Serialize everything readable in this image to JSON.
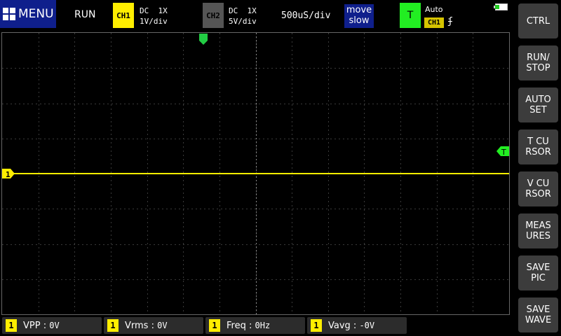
{
  "topbar": {
    "menu_label": "MENU",
    "run_state": "RUN",
    "ch1": {
      "badge": "CH1",
      "coupling": "DC  1X",
      "scale": "1V/div",
      "color": "#ffee00"
    },
    "ch2": {
      "badge": "CH2",
      "coupling": "DC  1X",
      "scale": "5V/div",
      "color": "#555555"
    },
    "timebase": "500uS/div",
    "move": {
      "line1": "move",
      "line2": "slow"
    },
    "trigger": {
      "badge": "T",
      "mode": "Auto",
      "source": "CH1",
      "edge": "ʄ",
      "color": "#22ee22"
    }
  },
  "markers": {
    "ch1_label": "1",
    "trigger_level_label": "T"
  },
  "side_buttons": [
    {
      "label": "CTRL"
    },
    {
      "label": "RUN/\nSTOP"
    },
    {
      "label": "AUTO\nSET"
    },
    {
      "label": "T CU\nRSOR"
    },
    {
      "label": "V CU\nRSOR"
    },
    {
      "label": "MEAS\nURES"
    },
    {
      "label": "SAVE\nPIC"
    },
    {
      "label": "SAVE\nWAVE"
    }
  ],
  "measurements": [
    {
      "channel": "1",
      "name": "VPP",
      "sep": " : ",
      "value": "0V"
    },
    {
      "channel": "1",
      "name": "Vrms",
      "sep": " : ",
      "value": "0V"
    },
    {
      "channel": "1",
      "name": "Freq",
      "sep": " : ",
      "value": "0Hz"
    },
    {
      "channel": "1",
      "name": "Vavg",
      "sep": " : ",
      "value": "-0V"
    }
  ]
}
